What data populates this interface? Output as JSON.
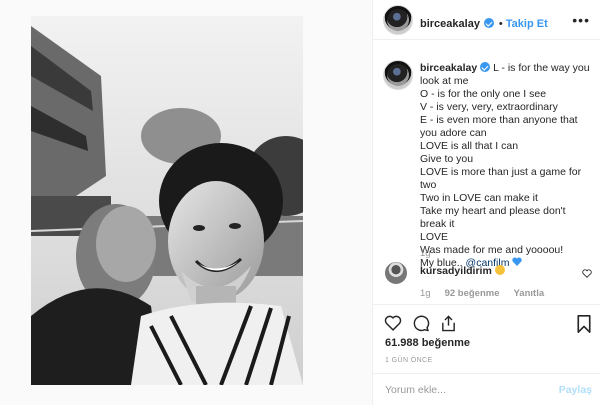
{
  "post": {
    "username": "birceakalay",
    "follow_label": "Takip Et",
    "more_label": "•••"
  },
  "caption": {
    "lines": [
      "L - is for the way you look at me",
      "O - is for the only one I see",
      "V - is very, very, extraordinary",
      "E - is even more than anyone that you adore can",
      "LOVE is all that I can",
      "Give to you",
      "LOVE is more than just a game for two",
      "Two in LOVE can make it",
      "Take my heart and please don't break it",
      "LOVE",
      "Was made for me and yoooou!"
    ],
    "last_line_prefix": "My blue.. ",
    "mention": "@canfilm",
    "time": "1g"
  },
  "comment": {
    "username": "kursadyildirim",
    "time": "1g",
    "likes": "92 beğenme",
    "reply_label": "Yanıtla"
  },
  "stats": {
    "likes": "61.988 beğenme",
    "posted": "1 GÜN ÖNCE"
  },
  "composer": {
    "placeholder": "Yorum ekle...",
    "post_label": "Paylaş"
  },
  "colors": {
    "accent": "#3897f0",
    "post_disabled": "#b2dffc",
    "border": "#efefef"
  },
  "icons": [
    "verified-badge-icon",
    "heart-icon",
    "comment-icon",
    "share-icon",
    "bookmark-icon",
    "smile-emoji-icon",
    "blue-heart-emoji-icon"
  ]
}
